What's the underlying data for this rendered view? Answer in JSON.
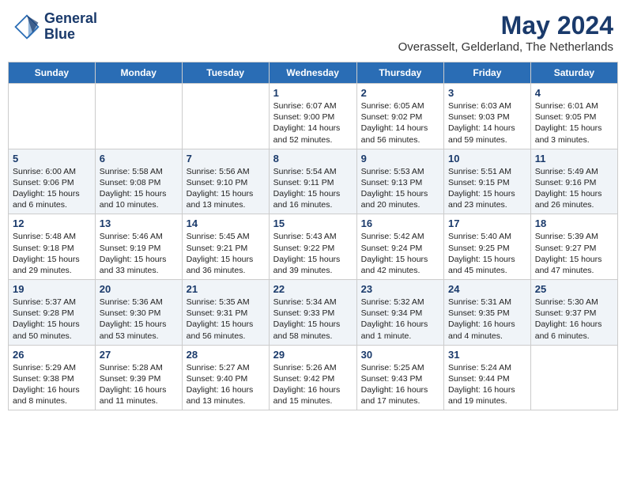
{
  "header": {
    "logo_line1": "General",
    "logo_line2": "Blue",
    "title": "May 2024",
    "subtitle": "Overasselt, Gelderland, The Netherlands"
  },
  "days_of_week": [
    "Sunday",
    "Monday",
    "Tuesday",
    "Wednesday",
    "Thursday",
    "Friday",
    "Saturday"
  ],
  "weeks": [
    [
      {
        "date": "",
        "content": ""
      },
      {
        "date": "",
        "content": ""
      },
      {
        "date": "",
        "content": ""
      },
      {
        "date": "1",
        "content": "Sunrise: 6:07 AM\nSunset: 9:00 PM\nDaylight: 14 hours\nand 52 minutes."
      },
      {
        "date": "2",
        "content": "Sunrise: 6:05 AM\nSunset: 9:02 PM\nDaylight: 14 hours\nand 56 minutes."
      },
      {
        "date": "3",
        "content": "Sunrise: 6:03 AM\nSunset: 9:03 PM\nDaylight: 14 hours\nand 59 minutes."
      },
      {
        "date": "4",
        "content": "Sunrise: 6:01 AM\nSunset: 9:05 PM\nDaylight: 15 hours\nand 3 minutes."
      }
    ],
    [
      {
        "date": "5",
        "content": "Sunrise: 6:00 AM\nSunset: 9:06 PM\nDaylight: 15 hours\nand 6 minutes."
      },
      {
        "date": "6",
        "content": "Sunrise: 5:58 AM\nSunset: 9:08 PM\nDaylight: 15 hours\nand 10 minutes."
      },
      {
        "date": "7",
        "content": "Sunrise: 5:56 AM\nSunset: 9:10 PM\nDaylight: 15 hours\nand 13 minutes."
      },
      {
        "date": "8",
        "content": "Sunrise: 5:54 AM\nSunset: 9:11 PM\nDaylight: 15 hours\nand 16 minutes."
      },
      {
        "date": "9",
        "content": "Sunrise: 5:53 AM\nSunset: 9:13 PM\nDaylight: 15 hours\nand 20 minutes."
      },
      {
        "date": "10",
        "content": "Sunrise: 5:51 AM\nSunset: 9:15 PM\nDaylight: 15 hours\nand 23 minutes."
      },
      {
        "date": "11",
        "content": "Sunrise: 5:49 AM\nSunset: 9:16 PM\nDaylight: 15 hours\nand 26 minutes."
      }
    ],
    [
      {
        "date": "12",
        "content": "Sunrise: 5:48 AM\nSunset: 9:18 PM\nDaylight: 15 hours\nand 29 minutes."
      },
      {
        "date": "13",
        "content": "Sunrise: 5:46 AM\nSunset: 9:19 PM\nDaylight: 15 hours\nand 33 minutes."
      },
      {
        "date": "14",
        "content": "Sunrise: 5:45 AM\nSunset: 9:21 PM\nDaylight: 15 hours\nand 36 minutes."
      },
      {
        "date": "15",
        "content": "Sunrise: 5:43 AM\nSunset: 9:22 PM\nDaylight: 15 hours\nand 39 minutes."
      },
      {
        "date": "16",
        "content": "Sunrise: 5:42 AM\nSunset: 9:24 PM\nDaylight: 15 hours\nand 42 minutes."
      },
      {
        "date": "17",
        "content": "Sunrise: 5:40 AM\nSunset: 9:25 PM\nDaylight: 15 hours\nand 45 minutes."
      },
      {
        "date": "18",
        "content": "Sunrise: 5:39 AM\nSunset: 9:27 PM\nDaylight: 15 hours\nand 47 minutes."
      }
    ],
    [
      {
        "date": "19",
        "content": "Sunrise: 5:37 AM\nSunset: 9:28 PM\nDaylight: 15 hours\nand 50 minutes."
      },
      {
        "date": "20",
        "content": "Sunrise: 5:36 AM\nSunset: 9:30 PM\nDaylight: 15 hours\nand 53 minutes."
      },
      {
        "date": "21",
        "content": "Sunrise: 5:35 AM\nSunset: 9:31 PM\nDaylight: 15 hours\nand 56 minutes."
      },
      {
        "date": "22",
        "content": "Sunrise: 5:34 AM\nSunset: 9:33 PM\nDaylight: 15 hours\nand 58 minutes."
      },
      {
        "date": "23",
        "content": "Sunrise: 5:32 AM\nSunset: 9:34 PM\nDaylight: 16 hours\nand 1 minute."
      },
      {
        "date": "24",
        "content": "Sunrise: 5:31 AM\nSunset: 9:35 PM\nDaylight: 16 hours\nand 4 minutes."
      },
      {
        "date": "25",
        "content": "Sunrise: 5:30 AM\nSunset: 9:37 PM\nDaylight: 16 hours\nand 6 minutes."
      }
    ],
    [
      {
        "date": "26",
        "content": "Sunrise: 5:29 AM\nSunset: 9:38 PM\nDaylight: 16 hours\nand 8 minutes."
      },
      {
        "date": "27",
        "content": "Sunrise: 5:28 AM\nSunset: 9:39 PM\nDaylight: 16 hours\nand 11 minutes."
      },
      {
        "date": "28",
        "content": "Sunrise: 5:27 AM\nSunset: 9:40 PM\nDaylight: 16 hours\nand 13 minutes."
      },
      {
        "date": "29",
        "content": "Sunrise: 5:26 AM\nSunset: 9:42 PM\nDaylight: 16 hours\nand 15 minutes."
      },
      {
        "date": "30",
        "content": "Sunrise: 5:25 AM\nSunset: 9:43 PM\nDaylight: 16 hours\nand 17 minutes."
      },
      {
        "date": "31",
        "content": "Sunrise: 5:24 AM\nSunset: 9:44 PM\nDaylight: 16 hours\nand 19 minutes."
      },
      {
        "date": "",
        "content": ""
      }
    ]
  ]
}
